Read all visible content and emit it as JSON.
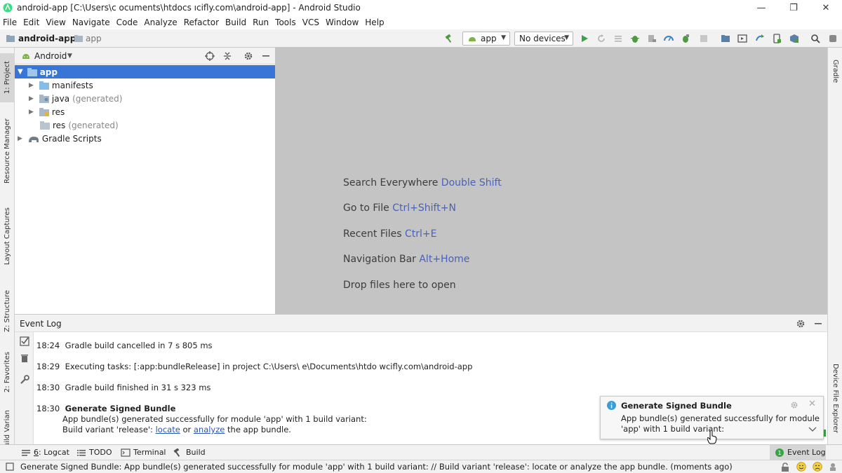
{
  "window": {
    "title": "android-app [C:\\Users\\c                    ocuments\\htdocs                    ıcifly.com\\android-app] - Android Studio",
    "minimize_glyph": "—",
    "maximize_glyph": "❐",
    "close_glyph": "✕"
  },
  "menu": [
    "File",
    "Edit",
    "View",
    "Navigate",
    "Code",
    "Analyze",
    "Refactor",
    "Build",
    "Run",
    "Tools",
    "VCS",
    "Window",
    "Help"
  ],
  "toolbar": {
    "breadcrumb_project": "android-app",
    "breadcrumb_module": "app",
    "run_config": "app",
    "device": "No devices"
  },
  "left_tabs": [
    "1: Project",
    "Resource Manager",
    "Layout Captures",
    "Z: Structure",
    "2: Favorites",
    "Build Variants"
  ],
  "right_tabs": [
    "Gradle",
    "Device File Explorer"
  ],
  "project": {
    "view_mode": "Android",
    "tree": [
      {
        "label": "app",
        "suffix": ""
      },
      {
        "label": "manifests",
        "suffix": ""
      },
      {
        "label": "java",
        "suffix": "(generated)"
      },
      {
        "label": "res",
        "suffix": ""
      },
      {
        "label": "res",
        "suffix": "(generated)"
      },
      {
        "label": "Gradle Scripts",
        "suffix": ""
      }
    ]
  },
  "editor": {
    "hints": [
      {
        "text": "Search Everywhere",
        "key": "Double Shift"
      },
      {
        "text": "Go to File",
        "key": "Ctrl+Shift+N"
      },
      {
        "text": "Recent Files",
        "key": "Ctrl+E"
      },
      {
        "text": "Navigation Bar",
        "key": "Alt+Home"
      },
      {
        "text": "Drop files here to open",
        "key": ""
      }
    ]
  },
  "event_log": {
    "title": "Event Log",
    "entries": [
      {
        "time": "18:24",
        "text": "Gradle build cancelled in 7 s 805 ms"
      },
      {
        "time": "18:29",
        "text": "Executing tasks: [:app:bundleRelease] in project C:\\Users\\                    e\\Documents\\htdo                    wcifly.com\\android-app"
      },
      {
        "time": "18:30",
        "text": "Gradle build finished in 31 s 323 ms"
      },
      {
        "time": "18:30",
        "text": "Generate Signed Bundle"
      }
    ],
    "bundle_line1": "App bundle(s) generated successfully for module 'app' with 1 build variant:",
    "bundle_line2_prefix": "Build variant 'release':",
    "locate": "locate",
    "or": "or",
    "analyze": "analyze",
    "bundle_line2_suffix": "the app bundle."
  },
  "notification": {
    "title": "Generate Signed Bundle",
    "line1": "App bundle(s) generated successfully for module",
    "line2": "'app' with 1 build variant:"
  },
  "bottom_tabs": [
    {
      "num": "6",
      "label": ": Logcat"
    },
    {
      "num": "",
      "label": "TODO"
    },
    {
      "num": "",
      "label": "Terminal"
    },
    {
      "num": "",
      "label": "Build"
    }
  ],
  "event_log_tab": "Event Log",
  "status": {
    "message": "Generate Signed Bundle: App bundle(s) generated successfully for module 'app' with 1 build variant: // Build variant 'release': locate or analyze the app bundle. (moments ago)"
  },
  "colors": {
    "accent": "#3875d7",
    "link": "#2a55b8",
    "run_green": "#3aa349",
    "android_green": "#7cb342",
    "editor_bg": "#c4c4c4"
  }
}
